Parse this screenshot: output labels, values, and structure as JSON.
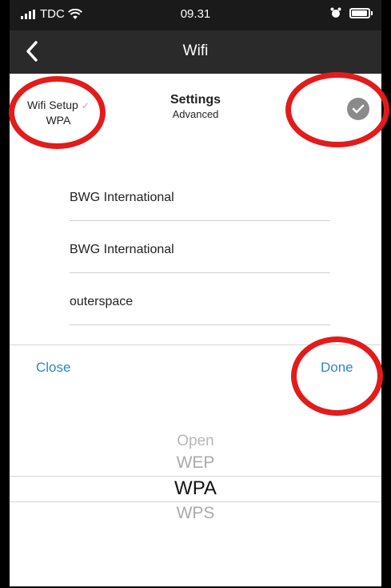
{
  "status": {
    "carrier": "TDC",
    "time": "09.31"
  },
  "nav": {
    "title": "Wifi"
  },
  "settings": {
    "setup_label": "Wifi Setup",
    "setup_value": "WPA",
    "title": "Settings",
    "subtitle": "Advanced"
  },
  "fields": [
    {
      "value": "BWG International"
    },
    {
      "value": "BWG International"
    },
    {
      "value": "outerspace"
    }
  ],
  "toolbar": {
    "close_label": "Close",
    "done_label": "Done"
  },
  "picker": {
    "options": [
      "Open",
      "WEP",
      "WPA",
      "WPS"
    ],
    "selected": "WPA"
  },
  "colors": {
    "accent": "#2f86c8",
    "highlight_ring": "#e21b1b",
    "nav_bg": "#2a2a2a"
  }
}
